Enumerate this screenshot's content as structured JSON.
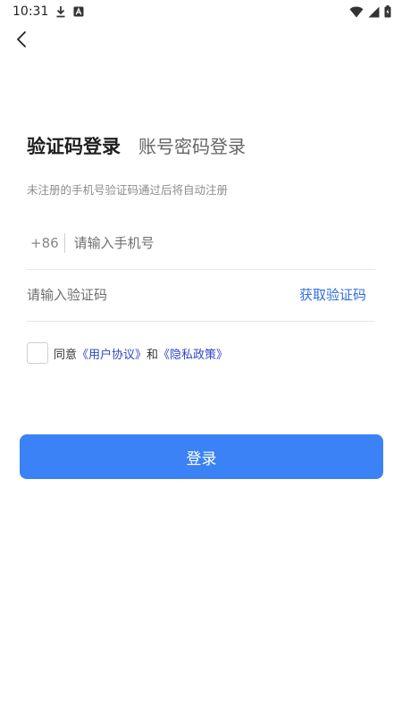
{
  "status_bar": {
    "time": "10:31",
    "icons_left": [
      "download-icon",
      "notification-a-icon"
    ],
    "icons_right": [
      "wifi-icon",
      "signal-icon",
      "battery-icon"
    ]
  },
  "nav": {
    "back_icon": "chevron-left-icon"
  },
  "tabs": {
    "active": "验证码登录",
    "inactive": "账号密码登录"
  },
  "hint": "未注册的手机号验证码通过后将自动注册",
  "phone": {
    "country_code": "+86",
    "placeholder": "请输入手机号",
    "value": ""
  },
  "code": {
    "placeholder": "请输入验证码",
    "value": "",
    "get_code_label": "获取验证码"
  },
  "agreement": {
    "prefix": "同意",
    "user_agreement": "《用户协议》",
    "conjunction": "和",
    "privacy_policy": "《隐私政策》",
    "checked": false
  },
  "login_button": {
    "label": "登录"
  },
  "colors": {
    "primary": "#3b82f6",
    "link": "#2f6fe0",
    "agreement_link": "#2f45c8"
  }
}
